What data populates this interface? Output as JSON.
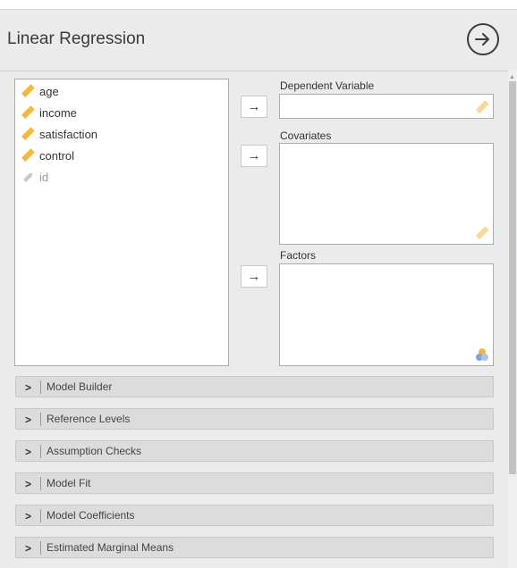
{
  "title": "Linear Regression",
  "variables": [
    {
      "name": "age",
      "icon": "ruler-icon"
    },
    {
      "name": "income",
      "icon": "ruler-icon"
    },
    {
      "name": "satisfaction",
      "icon": "ruler-icon"
    },
    {
      "name": "control",
      "icon": "ruler-icon"
    },
    {
      "name": "id",
      "icon": "id-tag-icon"
    }
  ],
  "arrow_symbol": "→",
  "targets": {
    "dependent": "Dependent Variable",
    "covariates": "Covariates",
    "factors": "Factors"
  },
  "sections": [
    "Model Builder",
    "Reference Levels",
    "Assumption Checks",
    "Model Fit",
    "Model Coefficients",
    "Estimated Marginal Means"
  ],
  "colors": {
    "ruler": "#f5b83d",
    "ruler_light": "#f9d99a",
    "id_tag": "#c8c8c8",
    "factor_blue": "#7da7d9",
    "factor_orange": "#f5b83d"
  }
}
